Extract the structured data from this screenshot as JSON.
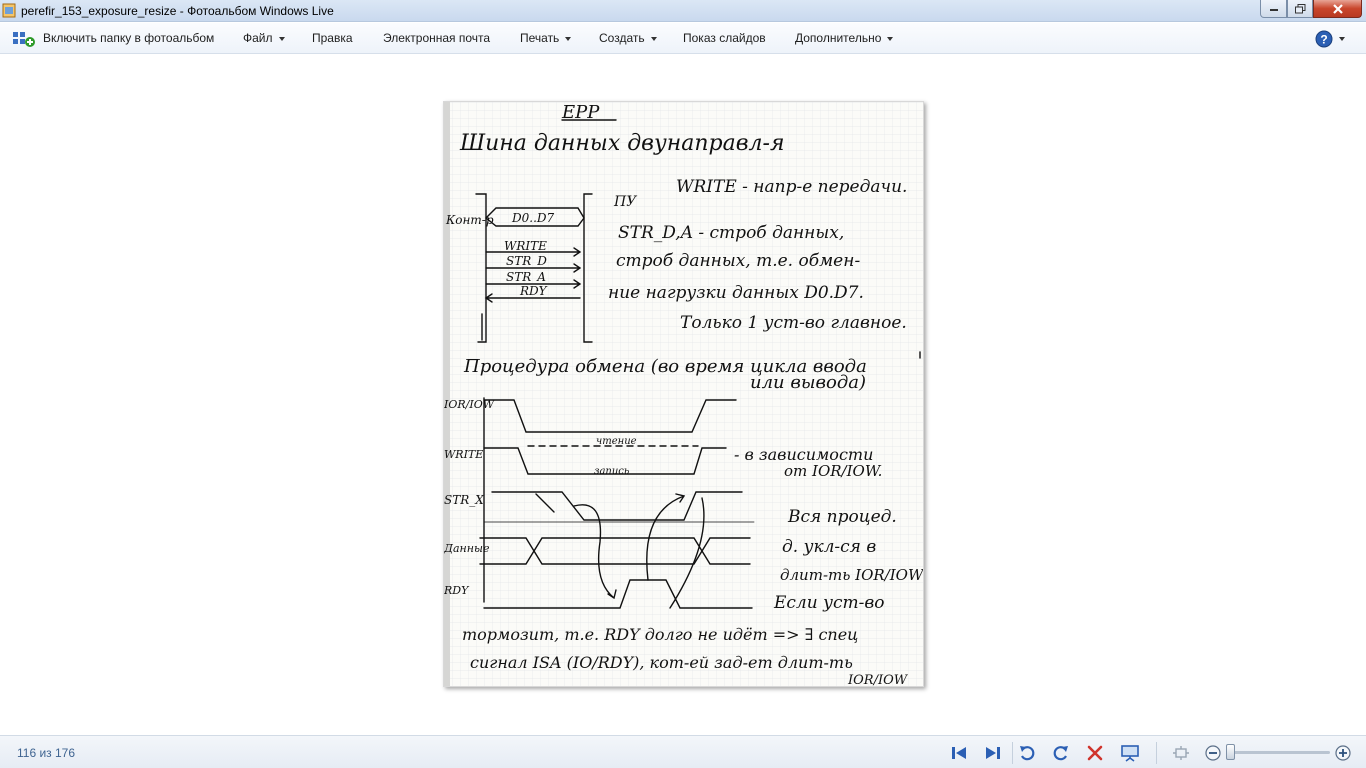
{
  "window": {
    "title": "perefir_153_exposure_resize - Фотоальбом Windows Live"
  },
  "menu": {
    "include_folder": "Включить папку в фотоальбом",
    "file": "Файл",
    "edit": "Правка",
    "email": "Электронная почта",
    "print": "Печать",
    "create": "Создать",
    "slideshow": "Показ слайдов",
    "more": "Дополнительно",
    "help_icon": "help-icon"
  },
  "photo": {
    "heading": "EPP",
    "line1": "Шина данных двунаправл-я",
    "left_label": "Конт-р",
    "bus_label": "D0..D7",
    "sig_write": "WRITE",
    "sig_strd": "STR_D",
    "sig_stra": "STR_A",
    "sig_rdy": "RDY",
    "px_label": "ПУ",
    "note1": "WRITE - напр-е передачи.",
    "note2": "STR_D,A - строб данных,",
    "note3": "строб данных, т.е. обмен-",
    "note4": "ние нагрузки данных D0.D7.",
    "note5": "Только 1 уст-во главное.",
    "proc1": "Процедура обмена (во время цикла ввода",
    "proc2": "или вывода)",
    "t_iorw": "IOR/IOW",
    "t_write": "WRITE",
    "t_read": "чтение",
    "t_wr": "запись",
    "t_strx": "STR_X",
    "t_data": "Данные",
    "t_rdy": "RDY",
    "dep1": "- в зависимости",
    "dep2": "от IOR/IOW.",
    "r1": "Вся процед.",
    "r2": "д. укл-ся в",
    "r3": "длит-ть IOR/IOW",
    "r4": "Если уст-во",
    "b1": "тормозит, т.е. RDY долго не идёт => ∃ спец",
    "b2": "сигнал ISA (IO/RDY), кот-ей зад-ет длит-ть",
    "b3": "IOR/IOW"
  },
  "status": {
    "counter": "116 из 176"
  },
  "toolbar_icons": {
    "first": "skip-first-icon",
    "next": "skip-next-icon",
    "rot_left": "rotate-left-icon",
    "rot_right": "rotate-right-icon",
    "delete": "delete-icon",
    "slideshow": "slideshow-icon",
    "fit": "fit-icon",
    "zoom_out": "zoom-out-icon",
    "zoom_in": "zoom-in-icon"
  },
  "zoom_level": 0.02
}
